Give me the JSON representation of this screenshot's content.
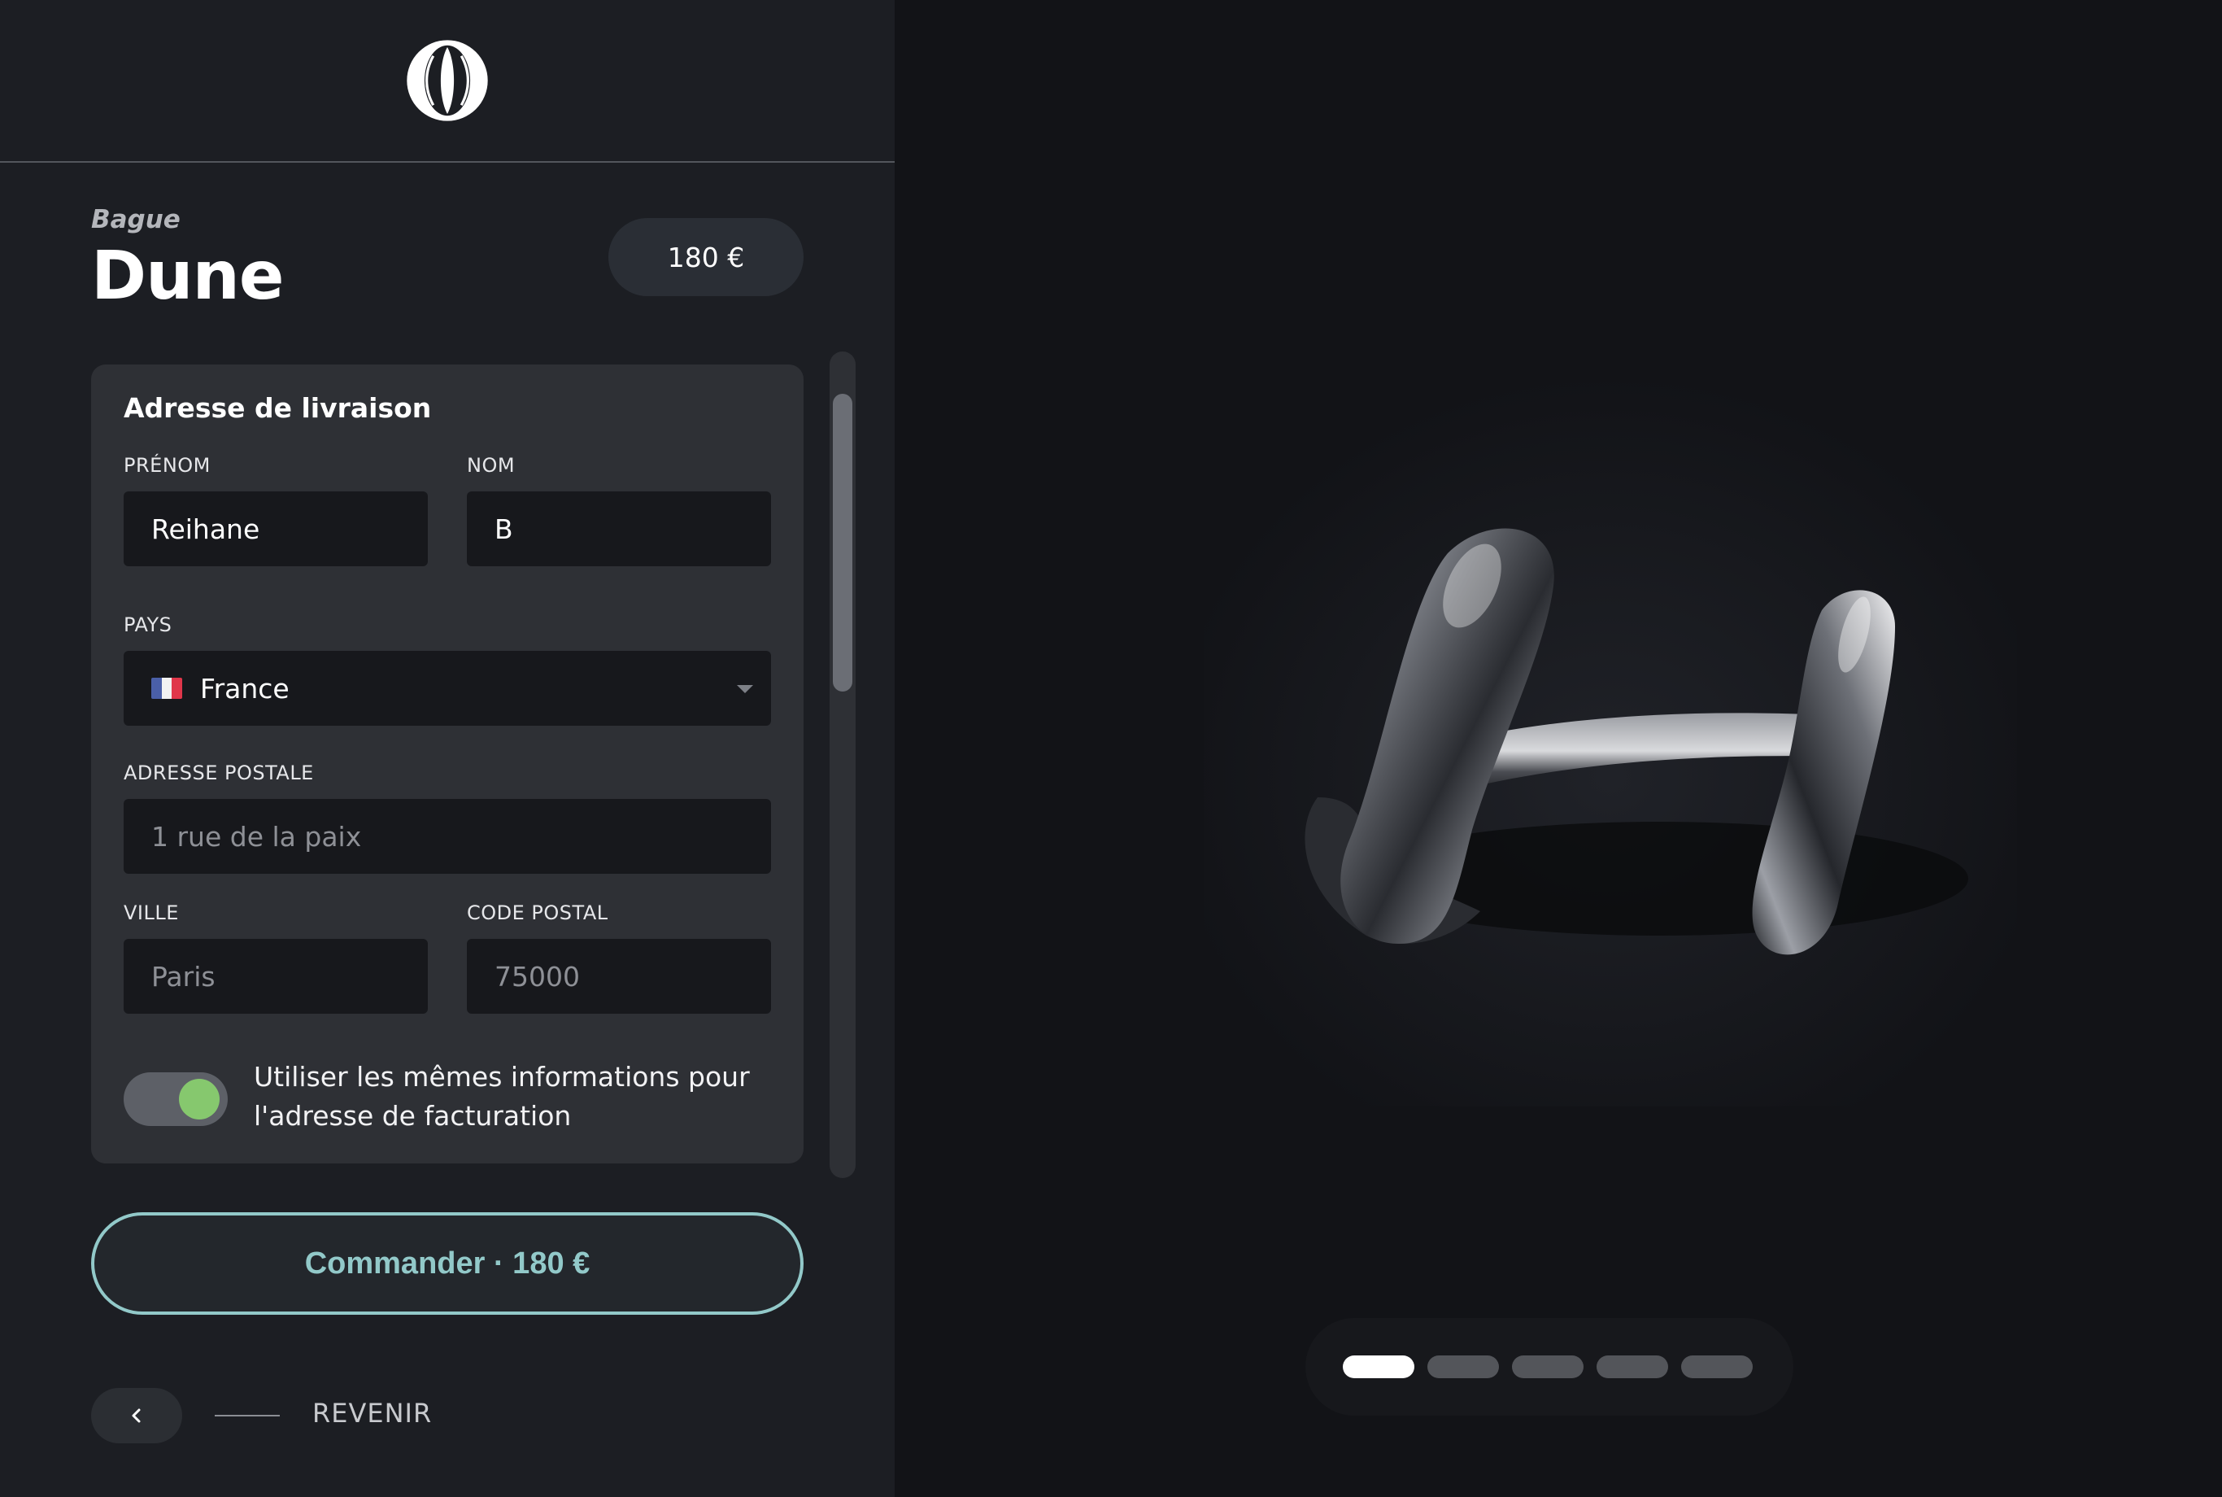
{
  "product": {
    "category": "Bague",
    "name": "Dune",
    "price": "180 €"
  },
  "form": {
    "title": "Adresse de livraison",
    "first_name": {
      "label": "PRÉNOM",
      "value": "Reihane"
    },
    "last_name": {
      "label": "NOM",
      "value": "B"
    },
    "country": {
      "label": "PAYS",
      "value": "France"
    },
    "address": {
      "label": "ADRESSE POSTALE",
      "placeholder": "1 rue de la paix"
    },
    "city": {
      "label": "VILLE",
      "placeholder": "Paris"
    },
    "postal_code": {
      "label": "CODE POSTAL",
      "placeholder": "75000"
    },
    "same_billing": {
      "text": "Utiliser les mêmes informations pour l'adresse de facturation",
      "checked": true
    }
  },
  "actions": {
    "order_label": "Commander · 180 €",
    "back_label": "REVENIR"
  },
  "gallery": {
    "slide_count": 5,
    "active_index": 0
  },
  "icons": {
    "logo": "brand-logo-icon",
    "back": "chevron-left-icon",
    "select": "caret-down-icon",
    "flag": "france-flag-icon"
  },
  "colors": {
    "accent": "#92c9c9",
    "toggle_on": "#86c86e",
    "panel": "#1c1e23",
    "card": "#2e3035",
    "input": "#17181c",
    "background": "#121317"
  }
}
